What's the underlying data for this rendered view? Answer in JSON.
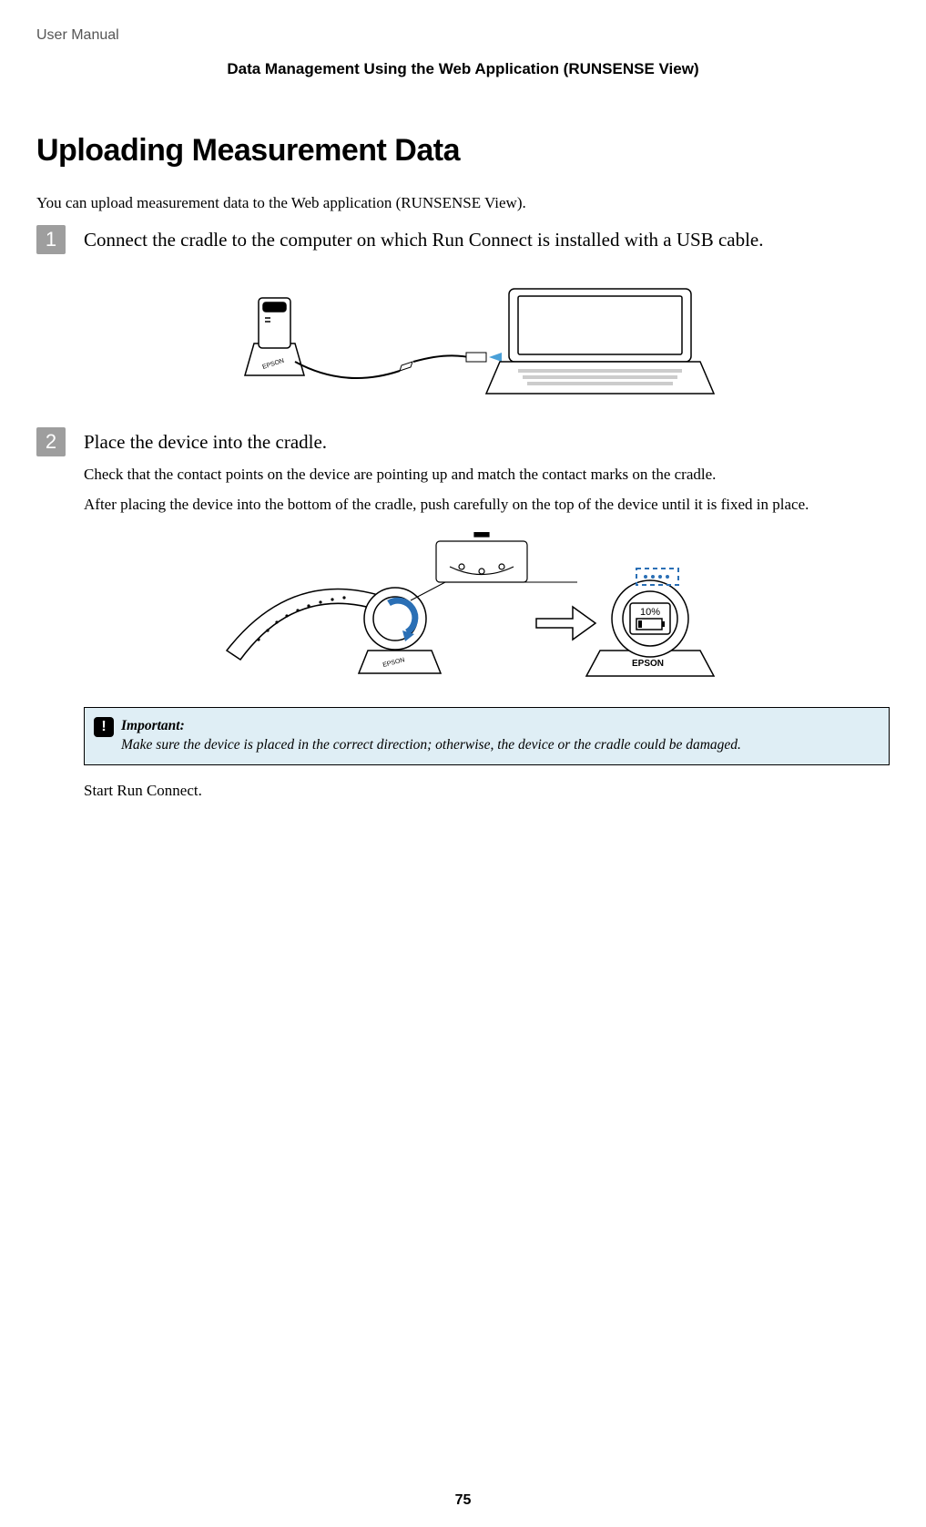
{
  "doc_type": "User Manual",
  "section_header": "Data Management Using the Web Application (RUNSENSE View)",
  "title": "Uploading Measurement Data",
  "intro": "You can upload measurement data to the Web application (RUNSENSE View).",
  "steps": [
    {
      "num": "1",
      "text": "Connect the cradle to the computer on which Run Connect is installed with a USB cable."
    },
    {
      "num": "2",
      "text": "Place the device into the cradle.",
      "body": [
        "Check that the contact points on the device are pointing up and match the contact marks on the cradle.",
        "After placing the device into the bottom of the cradle, push carefully on the top of the device until it is fixed in place."
      ]
    }
  ],
  "fig1_labels": {
    "brand": "EPSON"
  },
  "fig2_labels": {
    "brand": "EPSON",
    "percent": "10%"
  },
  "callout": {
    "label": "Important:",
    "text": "Make sure the device is placed in the correct direction; otherwise, the device or the cradle could be damaged."
  },
  "after_callout": "Start Run Connect.",
  "page_number": "75"
}
